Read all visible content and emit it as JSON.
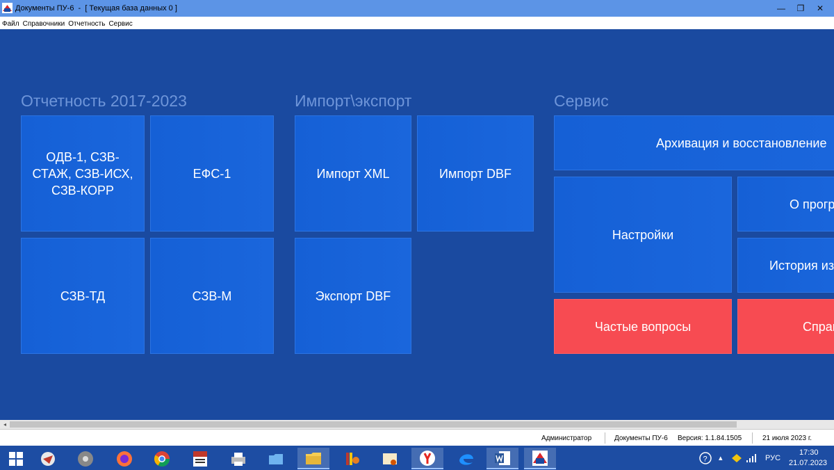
{
  "window": {
    "title": "Документы ПУ-6  -  [ Текущая база данных 0 ]",
    "minimize_glyph": "—",
    "maximize_glyph": "❐",
    "close_glyph": "✕"
  },
  "menu": [
    "Файл",
    "Справочники",
    "Отчетность",
    "Сервис"
  ],
  "groups": {
    "reporting": {
      "title": "Отчетность 2017-2023",
      "tiles": [
        "ОДВ-1, СЗВ-СТАЖ, СЗВ-ИСХ, СЗВ-КОРР",
        "ЕФС-1",
        "СЗВ-ТД",
        "СЗВ-М"
      ]
    },
    "import_export": {
      "title": "Импорт\\экспорт",
      "tiles": [
        "Импорт XML",
        "Импорт DBF",
        "Экспорт DBF"
      ]
    },
    "service": {
      "title": "Сервис",
      "tiles": [
        "Архивация и восстановление",
        "Настройки",
        "О прогр",
        "История из",
        "Частые вопросы",
        "Справ"
      ]
    }
  },
  "colors": {
    "background": "#1a4aa0",
    "tile_blue": "#1560d6",
    "tile_red": "#f74b52",
    "group_title": "#6e95d9"
  },
  "scrollbar": {
    "left_arrow": "◂"
  },
  "status": {
    "user": "Администратор",
    "app": "Документы ПУ-6",
    "version": "Версия: 1.1.84.1505",
    "date": "21 июля 2023 г."
  },
  "taskbar": {
    "apps": [
      "start-menu",
      "pinned-app-1",
      "pinned-app-2",
      "firefox",
      "chrome",
      "pdf-app",
      "printer-app",
      "folder-app",
      "file-explorer",
      "book-app",
      "certificate-app",
      "yandex-browser",
      "edge",
      "word",
      "pfr-app"
    ],
    "tray": {
      "language": "РУС",
      "time": "17:30",
      "date": "21.07.2023",
      "overflow_glyph": "▴"
    }
  }
}
